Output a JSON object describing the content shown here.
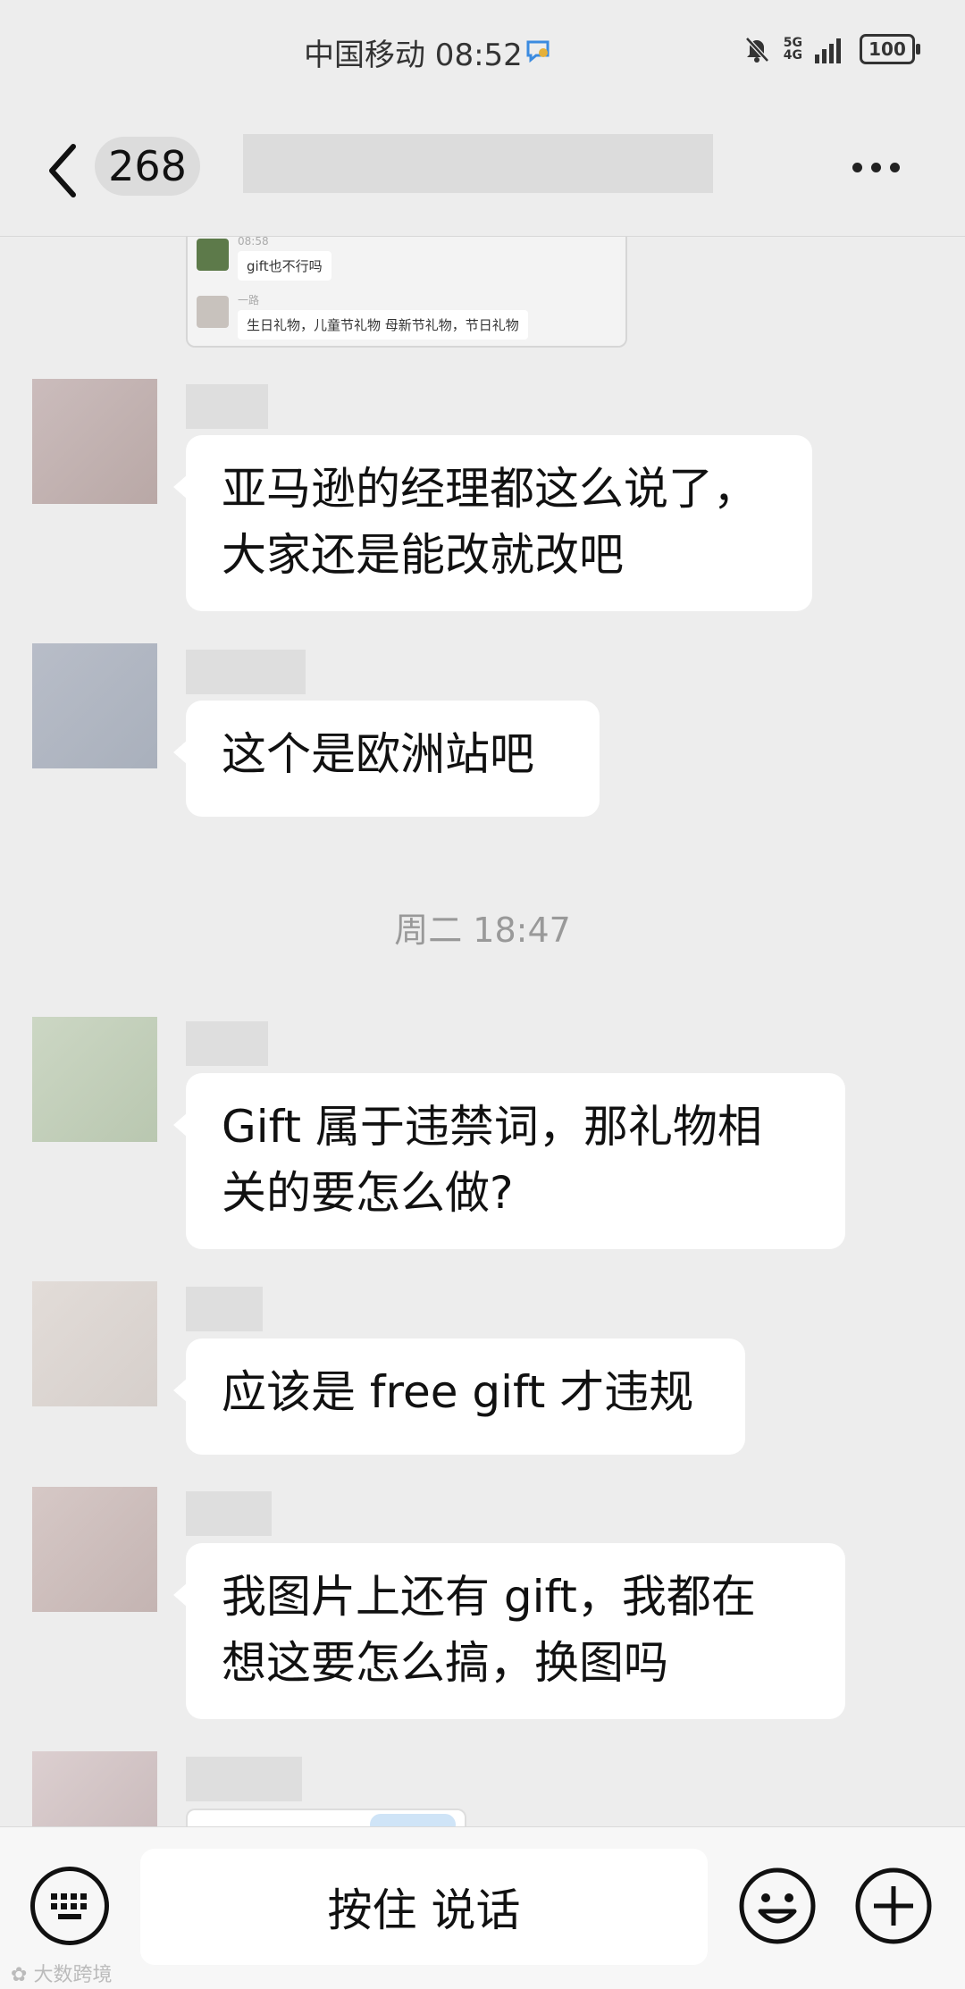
{
  "status_bar": {
    "carrier_time": "中国移动 08:52",
    "network": "5G",
    "network_sub": "4G",
    "battery": "100"
  },
  "nav": {
    "unread_count": "268"
  },
  "quoted_screenshot": {
    "time": "08:58",
    "msg1": "gift也不行吗",
    "sender2": "一路",
    "msg2": "生日礼物，儿童节礼物  母新节礼物，节日礼物"
  },
  "messages": [
    {
      "text_line1": "亚马逊的经理都这么说了，",
      "text_line2": "大家还是能改就改吧"
    },
    {
      "text_line1": "这个是欧洲站吧"
    },
    {
      "text_line1": "Gift 属于违禁词，那礼物相",
      "text_line2": "关的要怎么做?"
    },
    {
      "text_line1": "应该是 free gift 才违规"
    },
    {
      "text_line1": "我图片上还有 gift，我都在",
      "text_line2": "想这要怎么搞，换图吗"
    }
  ],
  "time_separator": "周二 18:47",
  "input_bar": {
    "voice_label": "按住 说话"
  },
  "watermark": "大数跨境"
}
